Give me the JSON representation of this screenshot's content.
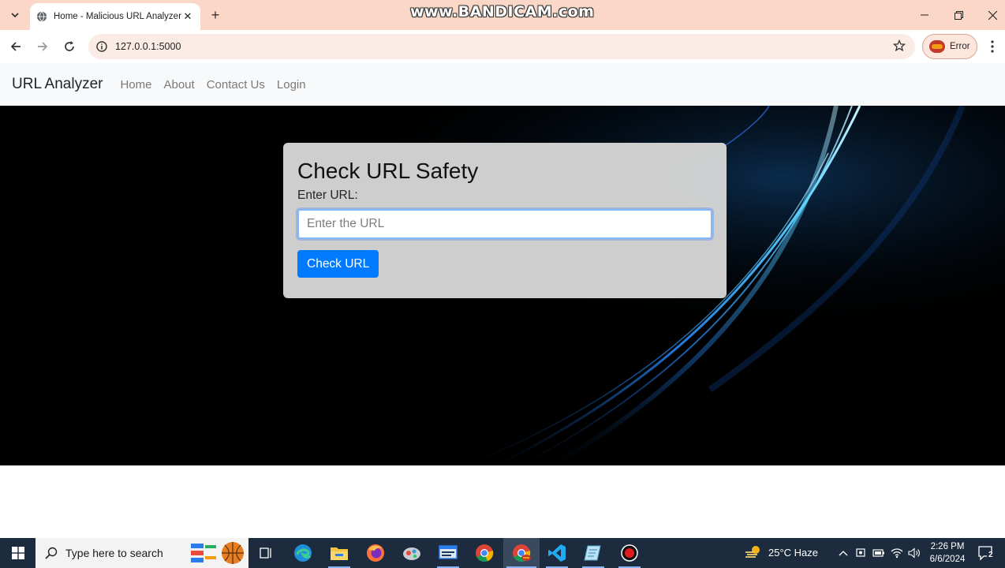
{
  "browser": {
    "tab_title": "Home - Malicious URL Analyzer",
    "watermark": "www.BANDICAM.com",
    "address": "127.0.0.1:5000",
    "profile_label": "Error"
  },
  "navbar": {
    "brand": "URL Analyzer",
    "links": [
      "Home",
      "About",
      "Contact Us",
      "Login"
    ]
  },
  "form": {
    "heading": "Check URL Safety",
    "field_label": "Enter URL:",
    "input_value": "",
    "input_placeholder": "Enter the URL",
    "submit_label": "Check URL"
  },
  "taskbar": {
    "search_placeholder": "Type here to search",
    "weather_text": "25°C  Haze",
    "time": "2:26 PM",
    "date": "6/6/2024",
    "notification_count": "2",
    "pinned_apps": [
      "task-view",
      "edge",
      "file-explorer",
      "firefox",
      "app",
      "app",
      "chrome",
      "chrome-active",
      "vscode",
      "app",
      "bandicam"
    ]
  },
  "colors": {
    "tab_strip": "#fad7c6",
    "primary_button": "#007bff",
    "navbar_bg": "#f8f9fa",
    "taskbar_bg": "#1c2b3d"
  }
}
